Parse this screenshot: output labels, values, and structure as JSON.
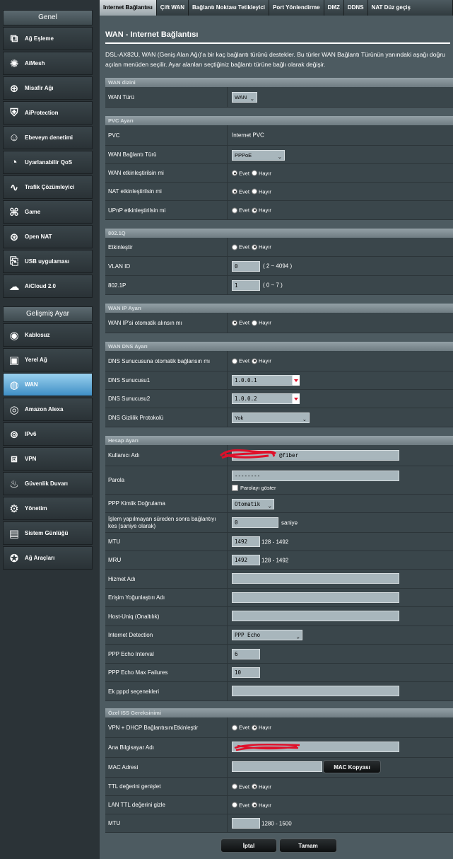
{
  "sidebar": {
    "general_title": "Genel",
    "general_items": [
      {
        "label": "Ağ Eşleme",
        "icon": "network-map-icon"
      },
      {
        "label": "AiMesh",
        "icon": "aimesh-icon"
      },
      {
        "label": "Misafir Ağı",
        "icon": "guest-network-icon"
      },
      {
        "label": "AiProtection",
        "icon": "shield-icon"
      },
      {
        "label": "Ebeveyn denetimi",
        "icon": "parental-control-icon"
      },
      {
        "label": "Uyarlanabilir QoS",
        "icon": "gauge-icon"
      },
      {
        "label": "Trafik Çözümleyici",
        "icon": "traffic-analyzer-icon"
      },
      {
        "label": "Game",
        "icon": "gamepad-icon"
      },
      {
        "label": "Open NAT",
        "icon": "open-nat-icon"
      },
      {
        "label": "USB uygulaması",
        "icon": "usb-icon"
      },
      {
        "label": "AiCloud 2.0",
        "icon": "cloud-icon"
      }
    ],
    "advanced_title": "Gelişmiş Ayar",
    "advanced_items": [
      {
        "label": "Kablosuz",
        "icon": "wifi-icon"
      },
      {
        "label": "Yerel Ağ",
        "icon": "lan-icon"
      },
      {
        "label": "WAN",
        "icon": "globe-icon",
        "active": true
      },
      {
        "label": "Amazon Alexa",
        "icon": "alexa-icon"
      },
      {
        "label": "IPv6",
        "icon": "ipv6-icon"
      },
      {
        "label": "VPN",
        "icon": "vpn-icon"
      },
      {
        "label": "Güvenlik Duvarı",
        "icon": "firewall-icon"
      },
      {
        "label": "Yönetim",
        "icon": "admin-gear-icon"
      },
      {
        "label": "Sistem Günlüğü",
        "icon": "system-log-icon"
      },
      {
        "label": "Ağ Araçları",
        "icon": "network-tools-icon"
      }
    ]
  },
  "tabs": [
    {
      "label": "Internet Bağlantısı",
      "active": true
    },
    {
      "label": "Çift WAN"
    },
    {
      "label": "Bağlantı Noktası Tetikleyici"
    },
    {
      "label": "Port Yönlendirme"
    },
    {
      "label": "DMZ"
    },
    {
      "label": "DDNS"
    },
    {
      "label": "NAT Düz geçiş"
    }
  ],
  "page": {
    "title": "WAN - Internet Bağlantısı",
    "description": "DSL-AX82U, WAN (Geniş Alan Ağı)'a bir kaç bağlantı türünü destekler. Bu türler WAN Bağlantı Türünün yanındaki aşağı doğru açılan menüden seçilir. Ayar alanları seçtiğiniz bağlantı türüne bağlı olarak değişir."
  },
  "radio": {
    "yes": "Evet",
    "no": "Hayır"
  },
  "wan_index": {
    "header": "WAN dizini",
    "wan_type_label": "WAN Türü",
    "wan_type_value": "WAN"
  },
  "pvc": {
    "header": "PVC Ayarı",
    "pvc_label": "PVC",
    "pvc_value": "Internet PVC",
    "conn_type_label": "WAN Bağlantı Türü",
    "conn_type_value": "PPPoE",
    "wan_enable_label": "WAN etkinleştirilsin mi",
    "nat_enable_label": "NAT etkinleştirilsin mi",
    "upnp_enable_label": "UPnP etkinleştirilsin mi"
  },
  "dot1q": {
    "header": "802.1Q",
    "enable_label": "Etkinleştir",
    "vlan_label": "VLAN ID",
    "vlan_value": "0",
    "vlan_range": "( 2 ~ 4094 )",
    "p_label": "802.1P",
    "p_value": "1",
    "p_range": "( 0 ~ 7 )"
  },
  "wan_ip": {
    "header": "WAN IP Ayarı",
    "auto_label": "WAN IP'si otomatik alınsın mı"
  },
  "wan_dns": {
    "header": "WAN DNS Ayarı",
    "auto_label": "DNS Sunucusuna otomatik bağlansın mı",
    "dns1_label": "DNS Sunucusu1",
    "dns1_value": "1.0.0.1",
    "dns2_label": "DNS Sunucusu2",
    "dns2_value": "1.0.0.2",
    "privacy_label": "DNS Gizlilik Protokolü",
    "privacy_value": "Yok"
  },
  "account": {
    "header": "Hesap Ayarı",
    "username_label": "Kullanıcı Adı",
    "username_value": "@fiber",
    "password_label": "Parola",
    "password_value": "--------",
    "show_password_label": "Parolayı göster",
    "auth_label": "PPP Kimlik Doğrulama",
    "auth_value": "Otomatik",
    "idle_label": "İşlem yapılmayan süreden sonra bağlantıyı kes (saniye olarak)",
    "idle_value": "0",
    "idle_unit": "saniye",
    "mtu_label": "MTU",
    "mtu_value": "1492",
    "mtu_range": "128 - 1492",
    "mru_label": "MRU",
    "mru_value": "1492",
    "mru_range": "128 - 1492",
    "service_label": "Hizmet Adı",
    "ac_label": "Erişim Yoğunlaştırı Adı",
    "hostuniq_label": "Host-Uniq (Onaltılık)",
    "detect_label": "Internet Detection",
    "detect_value": "PPP Echo",
    "echo_int_label": "PPP Echo Interval",
    "echo_int_value": "6",
    "echo_fail_label": "PPP Echo Max Failures",
    "echo_fail_value": "10",
    "pppd_label": "Ek pppd seçenekleri"
  },
  "isp": {
    "header": "Özel ISS Gereksinimi",
    "vpn_dhcp_label": "VPN + DHCP BağlantısınıEtkinleştir",
    "host_label": "Ana Bilgisayar Adı",
    "mac_label": "MAC Adresi",
    "mac_clone_label": "MAC Kopyası",
    "ttl_extend_label": "TTL değerini genişlet",
    "lan_ttl_label": "LAN TTL değerini gizle",
    "mtu_label": "MTU",
    "mtu_range": "1280 - 1500"
  },
  "buttons": {
    "cancel": "İptal",
    "apply": "Tamam"
  },
  "colors": {
    "active_tab": "#c7cdd0",
    "active_side": "#6db2de",
    "accent_red": "#e0102a"
  }
}
